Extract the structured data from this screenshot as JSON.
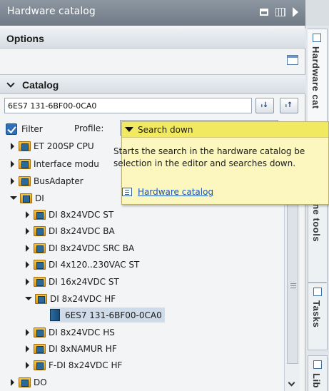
{
  "window": {
    "title": "Hardware catalog"
  },
  "options": {
    "label": "Options"
  },
  "catalog": {
    "label": "Catalog",
    "search_value": "6ES7 131-6BF00-0CA0",
    "search_down_button": "ᵢ↓",
    "search_up_button": "ᵢ↑",
    "filter_label": "Filter",
    "profile_label": "Profile:"
  },
  "tree": [
    {
      "label": "ET 200SP CPU"
    },
    {
      "label": "Interface modu"
    },
    {
      "label": "BusAdapter"
    },
    {
      "label": "DI"
    },
    {
      "label": "DI 8x24VDC ST"
    },
    {
      "label": "DI 8x24VDC BA"
    },
    {
      "label": "DI 8x24VDC SRC BA"
    },
    {
      "label": "DI 4x120..230VAC ST"
    },
    {
      "label": "DI 16x24VDC ST"
    },
    {
      "label": "DI 8x24VDC HF"
    },
    {
      "label": "6ES7 131-6BF00-0CA0"
    },
    {
      "label": "DI 8x24VDC HS"
    },
    {
      "label": "DI 8xNAMUR HF"
    },
    {
      "label": "F-DI 8x24VDC HF"
    },
    {
      "label": "DO"
    }
  ],
  "tooltip": {
    "title": "Search down",
    "line1": "Starts the search in the hardware catalog be",
    "line2": "selection in the editor and searches down.",
    "link": "Hardware catalog"
  },
  "sidebar": {
    "tab1": "Hardware cat",
    "tab2": "line tools",
    "tab3": "Tasks",
    "tab4": "Lib"
  }
}
